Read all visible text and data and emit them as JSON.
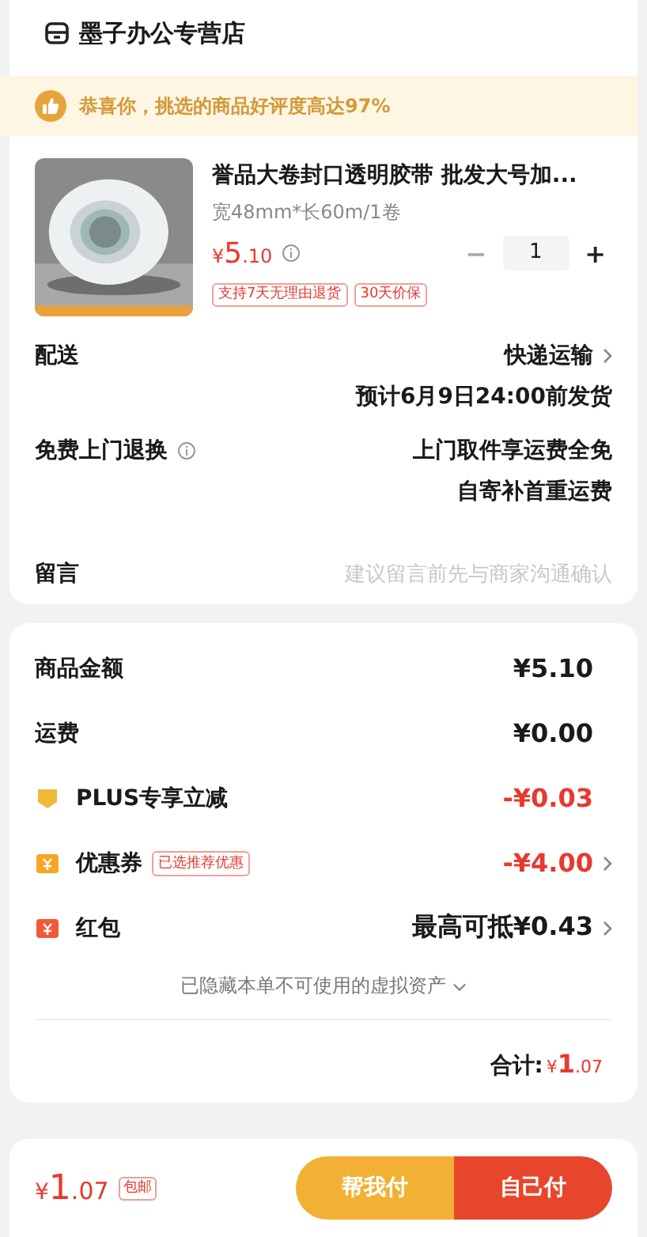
{
  "store": {
    "name": "墨子办公专营店"
  },
  "banner": {
    "text": "恭喜你，挑选的商品好评度高达97%"
  },
  "product": {
    "title": "誉品大卷封口透明胶带 批发大号加...",
    "spec": "宽48mm*长60m/1卷",
    "price": {
      "symbol": "¥",
      "integer": "5",
      "decimal": ".10"
    },
    "quantity": "1",
    "minus": "−",
    "plus": "+",
    "tags": [
      "支持7天无理由退货",
      "30天价保"
    ]
  },
  "delivery": [
    {
      "label": "配送",
      "info": false,
      "lines": [
        "快递运输",
        "预计6月9日24:00前发货"
      ],
      "chevron": true
    },
    {
      "label": "免费上门退换",
      "info": true,
      "lines": [
        "上门取件享运费全免",
        "自寄补首重运费"
      ],
      "chevron": false
    }
  ],
  "note": {
    "label": "留言",
    "placeholder": "建议留言前先与商家沟通确认"
  },
  "fees": [
    {
      "kind": "plain",
      "label": "商品金额",
      "value": "¥5.10",
      "highlight": false,
      "chevron": false
    },
    {
      "kind": "plain",
      "label": "运费",
      "value": "¥0.00",
      "highlight": false,
      "chevron": false
    },
    {
      "kind": "plus",
      "label": "PLUS专享立减",
      "value": "-¥0.03",
      "highlight": true,
      "chevron": false
    },
    {
      "kind": "coupon",
      "label": "优惠券",
      "tag": "已选推荐优惠",
      "value": "-¥4.00",
      "highlight": true,
      "chevron": true
    },
    {
      "kind": "redpacket",
      "label": "红包",
      "value": "最高可抵¥0.43",
      "highlight": false,
      "chevron": true
    }
  ],
  "hidden_assets": {
    "text": "已隐藏本单不可使用的虚拟资产",
    "expanded": false
  },
  "total": {
    "label": "合计:",
    "symbol": "¥",
    "integer": "1",
    "decimal": ".07"
  },
  "bottom_bar": {
    "symbol": "¥",
    "integer": "1",
    "decimal": ".07",
    "tag": "包邮",
    "buttons": [
      {
        "kind": "secondary",
        "label": "帮我付"
      },
      {
        "kind": "primary",
        "label": "自己付"
      }
    ]
  }
}
